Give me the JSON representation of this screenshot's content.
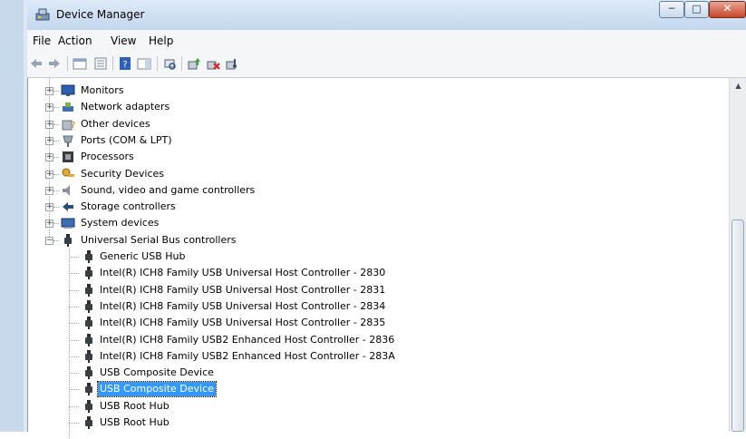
{
  "window": {
    "title": "Device Manager"
  },
  "menu": {
    "file": "File",
    "action": "Action",
    "view": "View",
    "help": "Help"
  },
  "toolbar": {
    "buttons": [
      "back-icon",
      "forward-icon",
      "show-hide-tree-icon",
      "properties-icon",
      "help-icon",
      "show-hide-action-pane-icon",
      "scan-hardware-icon",
      "update-driver-icon",
      "uninstall-icon",
      "disable-icon"
    ]
  },
  "tree": {
    "categories": [
      {
        "label": "Monitors",
        "icon": "monitor-icon"
      },
      {
        "label": "Network adapters",
        "icon": "network-adapter-icon"
      },
      {
        "label": "Other devices",
        "icon": "other-devices-icon"
      },
      {
        "label": "Ports (COM & LPT)",
        "icon": "port-icon"
      },
      {
        "label": "Processors",
        "icon": "processor-icon"
      },
      {
        "label": "Security Devices",
        "icon": "security-device-icon"
      },
      {
        "label": "Sound, video and game controllers",
        "icon": "sound-icon"
      },
      {
        "label": "Storage controllers",
        "icon": "storage-icon"
      },
      {
        "label": "System devices",
        "icon": "system-devices-icon"
      },
      {
        "label": "Universal Serial Bus controllers",
        "icon": "usb-icon"
      }
    ],
    "usb_children": [
      "Generic USB Hub",
      "Intel(R) ICH8 Family USB Universal Host Controller - 2830",
      "Intel(R) ICH8 Family USB Universal Host Controller - 2831",
      "Intel(R) ICH8 Family USB Universal Host Controller - 2834",
      "Intel(R) ICH8 Family USB Universal Host Controller - 2835",
      "Intel(R) ICH8 Family USB2 Enhanced Host Controller - 2836",
      "Intel(R) ICH8 Family USB2 Enhanced Host Controller - 283A",
      "USB Composite Device",
      "USB Composite Device",
      "USB Root Hub",
      "USB Root Hub"
    ],
    "selected_label": "USB Composite Device",
    "colors": {
      "selection": "#3399ff"
    }
  }
}
